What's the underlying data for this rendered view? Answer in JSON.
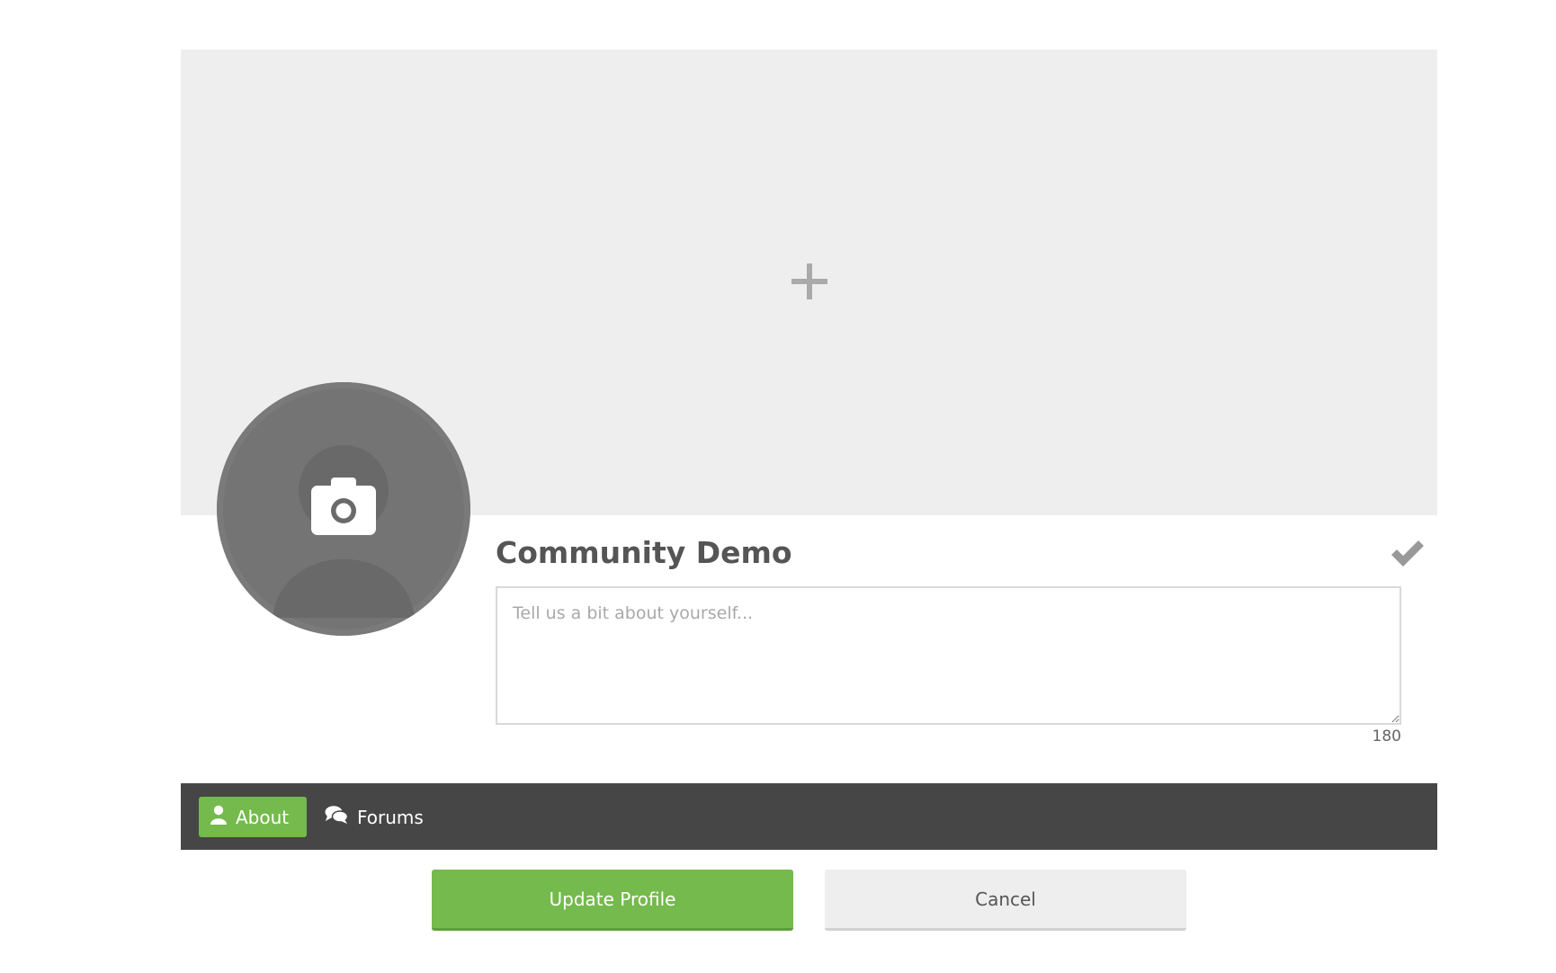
{
  "profile": {
    "display_name": "Community Demo",
    "about_placeholder": "Tell us a bit about yourself...",
    "about_value": "",
    "char_remaining": "180"
  },
  "cover": {
    "add_icon": "plus-icon"
  },
  "avatar": {
    "icon": "camera-icon",
    "placeholder": "default-user-silhouette"
  },
  "nav": {
    "tabs": [
      {
        "label": "About",
        "icon": "user-icon",
        "active": true
      },
      {
        "label": "Forums",
        "icon": "comments-icon",
        "active": false
      }
    ]
  },
  "actions": {
    "update_label": "Update Profile",
    "cancel_label": "Cancel"
  },
  "colors": {
    "accent": "#74ba4c",
    "nav_bg": "#464646",
    "cover_bg": "#eeeeee",
    "avatar_bg": "#7a7a7a"
  }
}
